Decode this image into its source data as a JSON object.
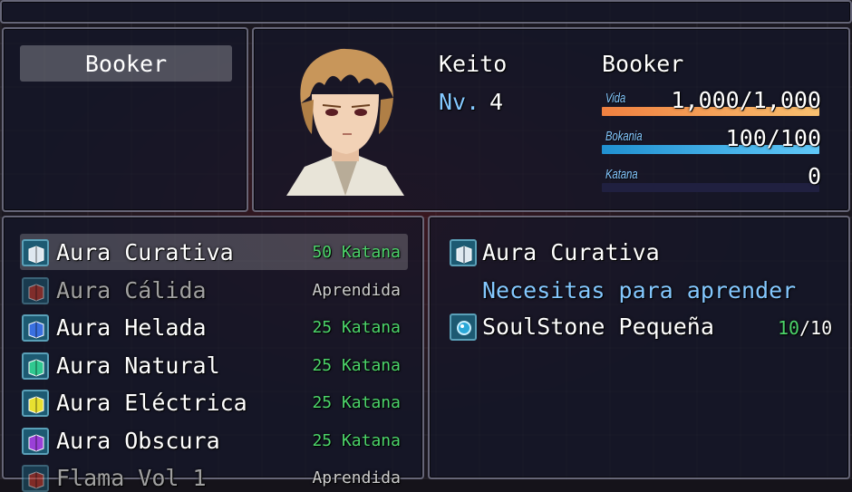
{
  "actor": {
    "tab_name": "Booker",
    "name": "Keito",
    "nickname": "Booker",
    "level_label": "Nv.",
    "level": "4",
    "gauges": [
      {
        "label": "Vida",
        "value": "1,000/1,000",
        "fill": 1.0,
        "color1": "#f08040",
        "color2": "#f8c070"
      },
      {
        "label": "Bokania",
        "value": "100/100",
        "fill": 1.0,
        "color1": "#2090d0",
        "color2": "#60c8f8"
      },
      {
        "label": "Katana",
        "value": "0",
        "fill": 0.0,
        "color1": "#80c040",
        "color2": "#c0f080"
      }
    ]
  },
  "skills": [
    {
      "name": "Aura Curativa",
      "status": "50 Katana",
      "learned": false,
      "icon": "book-white-icon",
      "icon_color": "#dfe8f0"
    },
    {
      "name": "Aura Cálida",
      "status": "Aprendida",
      "learned": true,
      "icon": "book-red-icon",
      "icon_color": "#d84030"
    },
    {
      "name": "Aura Helada",
      "status": "25 Katana",
      "learned": false,
      "icon": "book-blue-icon",
      "icon_color": "#3a70e0"
    },
    {
      "name": "Aura Natural",
      "status": "25 Katana",
      "learned": false,
      "icon": "book-green-icon",
      "icon_color": "#30c890"
    },
    {
      "name": "Aura Eléctrica",
      "status": "25 Katana",
      "learned": false,
      "icon": "book-yellow-icon",
      "icon_color": "#e8e030"
    },
    {
      "name": "Aura Obscura",
      "status": "25 Katana",
      "learned": false,
      "icon": "book-purple-icon",
      "icon_color": "#9a40d8"
    },
    {
      "name": "Flama Vol 1",
      "status": "Aprendida",
      "learned": true,
      "icon": "book-red-icon",
      "icon_color": "#d84030"
    }
  ],
  "detail": {
    "skill_name": "Aura Curativa",
    "requirement_heading": "Necesitas para aprender",
    "item_name": "SoulStone Pequeña",
    "owned": "10",
    "required": "/10"
  }
}
